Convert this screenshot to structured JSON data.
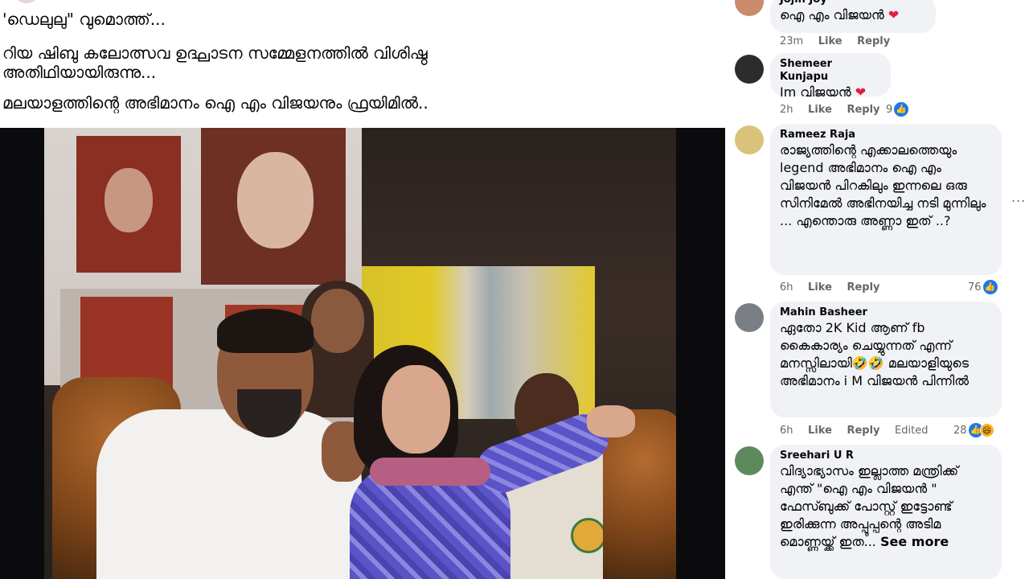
{
  "post": {
    "lines": [
      "'ഡെലുലു\" വുമൊത്ത്...",
      "റിയ ഷിബു കലോത്സവ ഉദ്ഘാടന സമ്മേളനത്തിൽ വിശിഷ്ഠ അതിഥിയായിരുന്നു...",
      "മലയാളത്തിന്റെ അഭിമാനം ഐ എം വിജയനും ഫ്രയിമിൽ.."
    ]
  },
  "comments": [
    {
      "name": "Jojin Joy",
      "text": "ഐ എം വിജയൻ",
      "emoji": "❤",
      "time": "23m",
      "like": "Like",
      "reply": "Reply",
      "reactions": "",
      "avatar_color": "#c98b6b"
    },
    {
      "name": "Shemeer Kunjapu",
      "text": "Im വിജയൻ",
      "emoji": "❤",
      "time": "2h",
      "like": "Like",
      "reply": "Reply",
      "reactions": "9",
      "avatar_color": "#2c2c2c"
    },
    {
      "name": "Rameez Raja",
      "text": "രാജ്യത്തിന്റെ എക്കാലത്തെയും legend അഭിമാനം ഐ എം വിജയൻ പിറകിലും ഇന്നലെ ഒരു സിനിമേൽ അഭിനയിച്ച നടി മുന്നിലും ... എന്തൊരു അണ്ണാ ഇത് ..?",
      "time": "6h",
      "like": "Like",
      "reply": "Reply",
      "reactions": "76",
      "avatar_color": "#d9c37a"
    },
    {
      "name": "Mahin Basheer",
      "text": "ഏതോ 2K Kid ആണ് fb കൈകാര്യം ചെയ്യുന്നത് എന്ന് മനസ്സിലായി🤣🤣 മലയാളിയുടെ അഭിമാനം i M വിജയൻ പിന്നിൽ",
      "time": "6h",
      "like": "Like",
      "reply": "Reply",
      "edited": "Edited",
      "reactions": "28",
      "avatar_color": "#7a7f86"
    },
    {
      "name": "Sreehari U R",
      "text": "വിദ്യാഭ്യാസം ഇല്ലാത്ത മന്ത്രിക്ക് എന്ത് \"ഐ എം വിജയൻ \" ഫേസ്ബുക്ക് പോസ്റ്റ് ഇട്ടോണ്ട് ഇരിക്കുന്ന അപ്പൂപ്പന്റെ അടിമ മൊണ്ണയ്ക്ക് ഇത...",
      "see_more": "See more",
      "avatar_color": "#5d8a5c"
    }
  ],
  "icons": {
    "like": "👍",
    "haha": "😆",
    "more": "..."
  }
}
